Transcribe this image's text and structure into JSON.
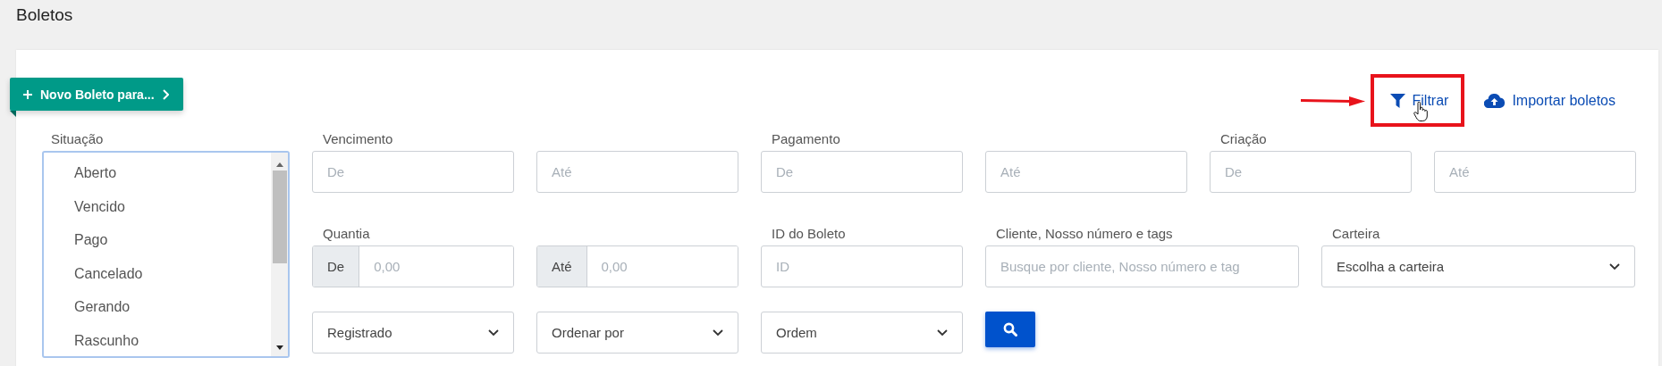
{
  "page_title": "Boletos",
  "new_button": {
    "label": "Novo Boleto para..."
  },
  "actions": [
    {
      "kind": "filter",
      "label": "Filtrar",
      "highlighted": true
    },
    {
      "kind": "upload",
      "label": "Importar boletos",
      "highlighted": false
    }
  ],
  "status_filter": {
    "label": "Situação",
    "options": [
      {
        "label": "Aberto",
        "selected": false
      },
      {
        "label": "Vencido",
        "selected": false
      },
      {
        "label": "Pago",
        "selected": false
      },
      {
        "label": "Cancelado",
        "selected": false
      },
      {
        "label": "Gerando",
        "selected": false
      },
      {
        "label": "Rascunho",
        "selected": false
      }
    ]
  },
  "date_ranges": [
    {
      "label": "Vencimento",
      "from_placeholder": "De",
      "to_placeholder": "Até"
    },
    {
      "label": "Pagamento",
      "from_placeholder": "De",
      "to_placeholder": "Até"
    },
    {
      "label": "Criação",
      "from_placeholder": "De",
      "to_placeholder": "Até"
    }
  ],
  "amount": {
    "label": "Quantia",
    "from_prefix": "De",
    "from_placeholder": "0,00",
    "to_prefix": "Até",
    "to_placeholder": "0,00"
  },
  "boleto_id": {
    "label": "ID do Boleto",
    "placeholder": "ID"
  },
  "client_search": {
    "label": "Cliente, Nosso número e tags",
    "placeholder": "Busque por cliente, Nosso número e tag"
  },
  "wallet": {
    "label": "Carteira",
    "value": "Escolha a carteira"
  },
  "bottom_selects": [
    {
      "value": "Registrado"
    },
    {
      "value": "Ordenar por"
    },
    {
      "value": "Ordem"
    }
  ]
}
